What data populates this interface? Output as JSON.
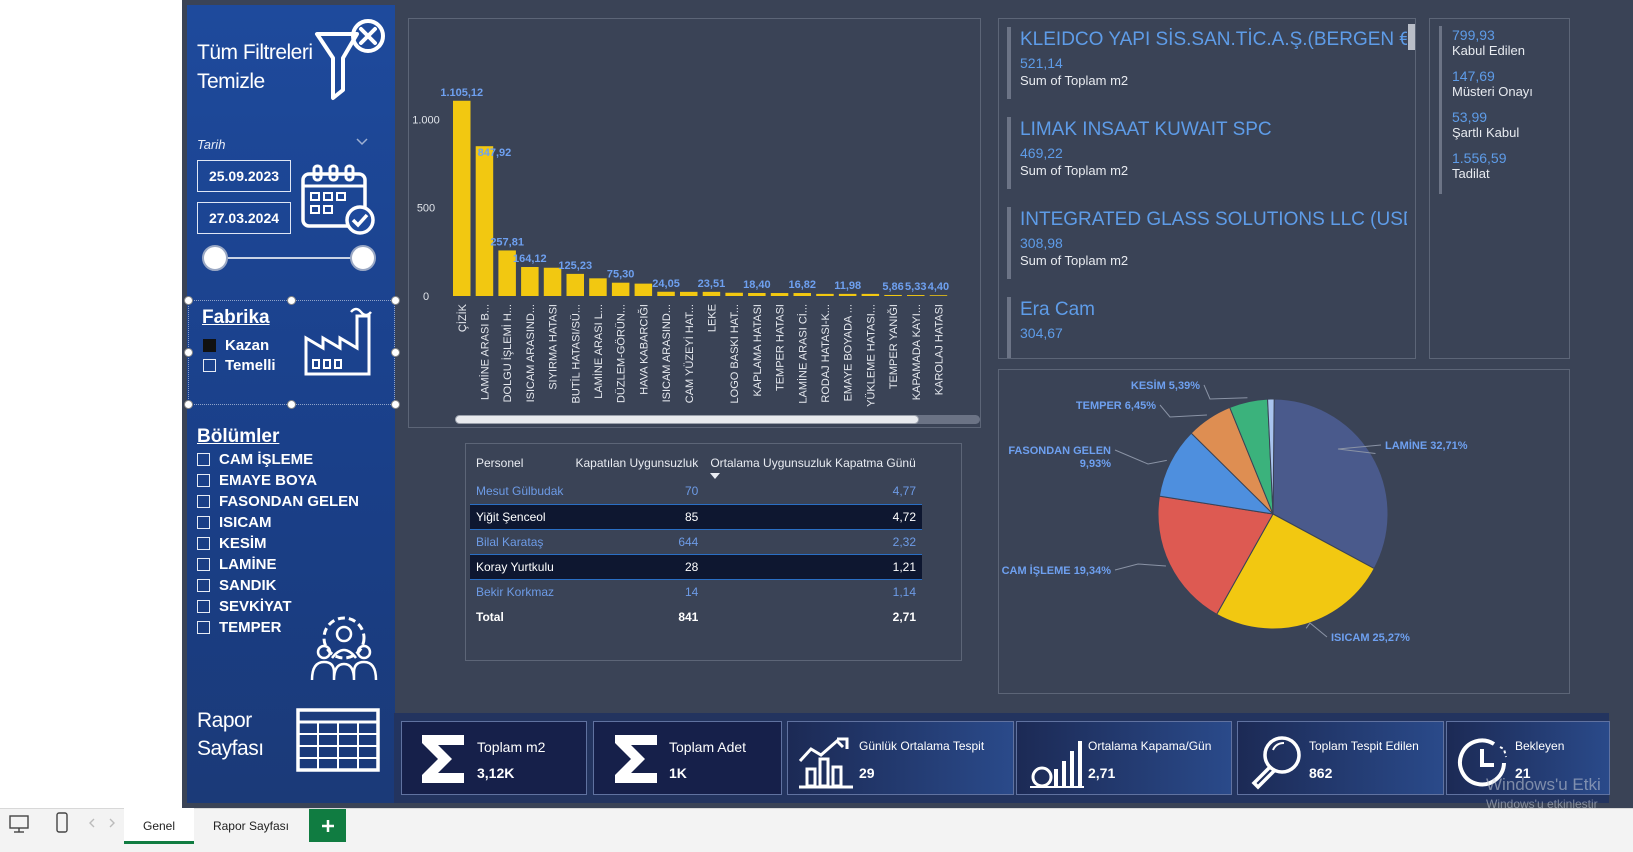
{
  "sidebar": {
    "clear_filters_line1": "Tüm Filtreleri",
    "clear_filters_line2": "Temizle",
    "date_label": "Tarih",
    "date_start": "25.09.2023",
    "date_end": "27.03.2024",
    "factory_title": "Fabrika",
    "factories": [
      {
        "label": "Kazan",
        "checked": true
      },
      {
        "label": "Temelli",
        "checked": false
      }
    ],
    "departments_title": "Bölümler",
    "departments": [
      "CAM İŞLEME",
      "EMAYE BOYA",
      "FASONDAN GELEN",
      "ISICAM",
      "KESİM",
      "LAMİNE",
      "SANDIK",
      "SEVKİYAT",
      "TEMPER"
    ],
    "report_line1": "Rapor",
    "report_line2": "Sayfası"
  },
  "chart_data": [
    {
      "type": "bar",
      "categories": [
        "ÇİZİK",
        "LAMİNE ARASI B...",
        "DOLGU İŞLEMİ H...",
        "ISICAM ARASIND...",
        "SIYIRMA HATASI",
        "BUTİL HATASI/SÜ...",
        "LAMİNE ARASI L...",
        "DÜZLEM-GÖRÜN...",
        "HAVA KABARCIĞI",
        "ISICAM ARASIND...",
        "CAM YÜZEYİ HAT...",
        "LEKE",
        "LOGO BASKI HAT...",
        "KAPLAMA HATASI",
        "TEMPER HATASI",
        "LAMİNE ARASI Cİ...",
        "RODAJ HATASI-K...",
        "EMAYE BOYADA ...",
        "YÜKLEME HATASI...",
        "TEMPER YANIĞI",
        "KAPAMADA KAYI...",
        "KAROLAJ HATASI"
      ],
      "values": [
        1105.12,
        847.92,
        257.81,
        164.12,
        160,
        125.23,
        100,
        75.3,
        70,
        24.05,
        23.51,
        23.51,
        18.4,
        17,
        16.82,
        16.82,
        12,
        11.98,
        11.98,
        5.86,
        5.33,
        4.4
      ],
      "data_labels": [
        "1.105,12",
        "847,92",
        "257,81",
        "164,12",
        "",
        "125,23",
        "",
        "75,30",
        "",
        "24,05",
        "",
        "23,51",
        "",
        "18,40",
        "",
        "16,82",
        "",
        "11,98",
        "",
        "5,86",
        "5,33",
        "4,40"
      ],
      "yticks": [
        "0",
        "500",
        "1.000"
      ],
      "ylim": [
        0,
        1200
      ],
      "color": "#f2c811"
    },
    {
      "type": "pie",
      "slices": [
        {
          "label": "LAMİNE",
          "value": 32.71,
          "text": "LAMİNE 32,71%",
          "color": "#4a5a8c"
        },
        {
          "label": "ISICAM",
          "value": 25.27,
          "text": "ISICAM 25,27%",
          "color": "#f2c811"
        },
        {
          "label": "CAM İŞLEME",
          "value": 19.34,
          "text": "CAM İŞLEME 19,34%",
          "color": "#dd5a52"
        },
        {
          "label": "FASONDAN GELEN",
          "value": 9.93,
          "text": "FASONDAN GELEN 9,93%",
          "color": "#4e8fde"
        },
        {
          "label": "TEMPER",
          "value": 6.45,
          "text": "TEMPER 6,45%",
          "color": "#de8e52"
        },
        {
          "label": "KESİM",
          "value": 5.39,
          "text": "KESİM 5,39%",
          "color": "#3bb27c"
        },
        {
          "label": "other",
          "value": 0.91,
          "text": "",
          "color": "#a9c4ee"
        }
      ]
    }
  ],
  "personnel_table": {
    "headers": [
      "Personel",
      "Kapatılan Uygunsuzluk",
      "Ortalama Uygunsuzluk Kapatma Günü"
    ],
    "rows": [
      [
        "Mesut Gülbudak",
        "70",
        "4,77"
      ],
      [
        "Yiğit Şenceol",
        "85",
        "4,72"
      ],
      [
        "Bilal Karataş",
        "644",
        "2,32"
      ],
      [
        "Koray Yurtkulu",
        "28",
        "1,21"
      ],
      [
        "Bekir Korkmaz",
        "14",
        "1,14"
      ]
    ],
    "total": [
      "Total",
      "841",
      "2,71"
    ]
  },
  "customers": [
    {
      "name": "KLEIDCO YAPI SİS.SAN.TİC.A.Ş.(BERGEN € )",
      "value": "521,14",
      "label": "Sum of Toplam m2"
    },
    {
      "name": "LIMAK INSAAT KUWAIT SPC",
      "value": "469,22",
      "label": "Sum of Toplam m2"
    },
    {
      "name": "INTEGRATED GLASS SOLUTIONS LLC (USD)",
      "value": "308,98",
      "label": "Sum of Toplam m2"
    },
    {
      "name": "Era Cam",
      "value": "304,67",
      "label": ""
    }
  ],
  "statuses": [
    {
      "value": "799,93",
      "label": "Kabul Edilen"
    },
    {
      "value": "147,69",
      "label": "Müsteri Onayı"
    },
    {
      "value": "53,99",
      "label": "Şartlı Kabul"
    },
    {
      "value": "1.556,59",
      "label": "Tadilat"
    }
  ],
  "kpis": [
    {
      "title": "Toplam m2",
      "value": "3,12K",
      "icon": "sigma-icon"
    },
    {
      "title": "Toplam Adet",
      "value": "1K",
      "icon": "sigma-icon"
    },
    {
      "title": "Günlük Ortalama Tespit",
      "value": "29",
      "icon": "chart-growth-icon"
    },
    {
      "title": "Ortalama Kapama/Gün",
      "value": "2,71",
      "icon": "gauge-bars-icon"
    },
    {
      "title": "Toplam Tespit Edilen",
      "value": "862",
      "icon": "magnifier-icon"
    },
    {
      "title": "Bekleyen",
      "value": "21",
      "icon": "clock-icon"
    }
  ],
  "tabs": {
    "tab1": "Genel",
    "tab2": "Rapor Sayfası"
  },
  "watermark": {
    "line1": "Windows'u Etki",
    "line2": "Windows'u etkinleştir"
  },
  "colors": {
    "accent": "#f2c811",
    "link_blue": "#5e9ce8",
    "sidebar_blue": "#1e4a9c",
    "canvas": "#3a4356",
    "excel_green": "#107c41"
  }
}
